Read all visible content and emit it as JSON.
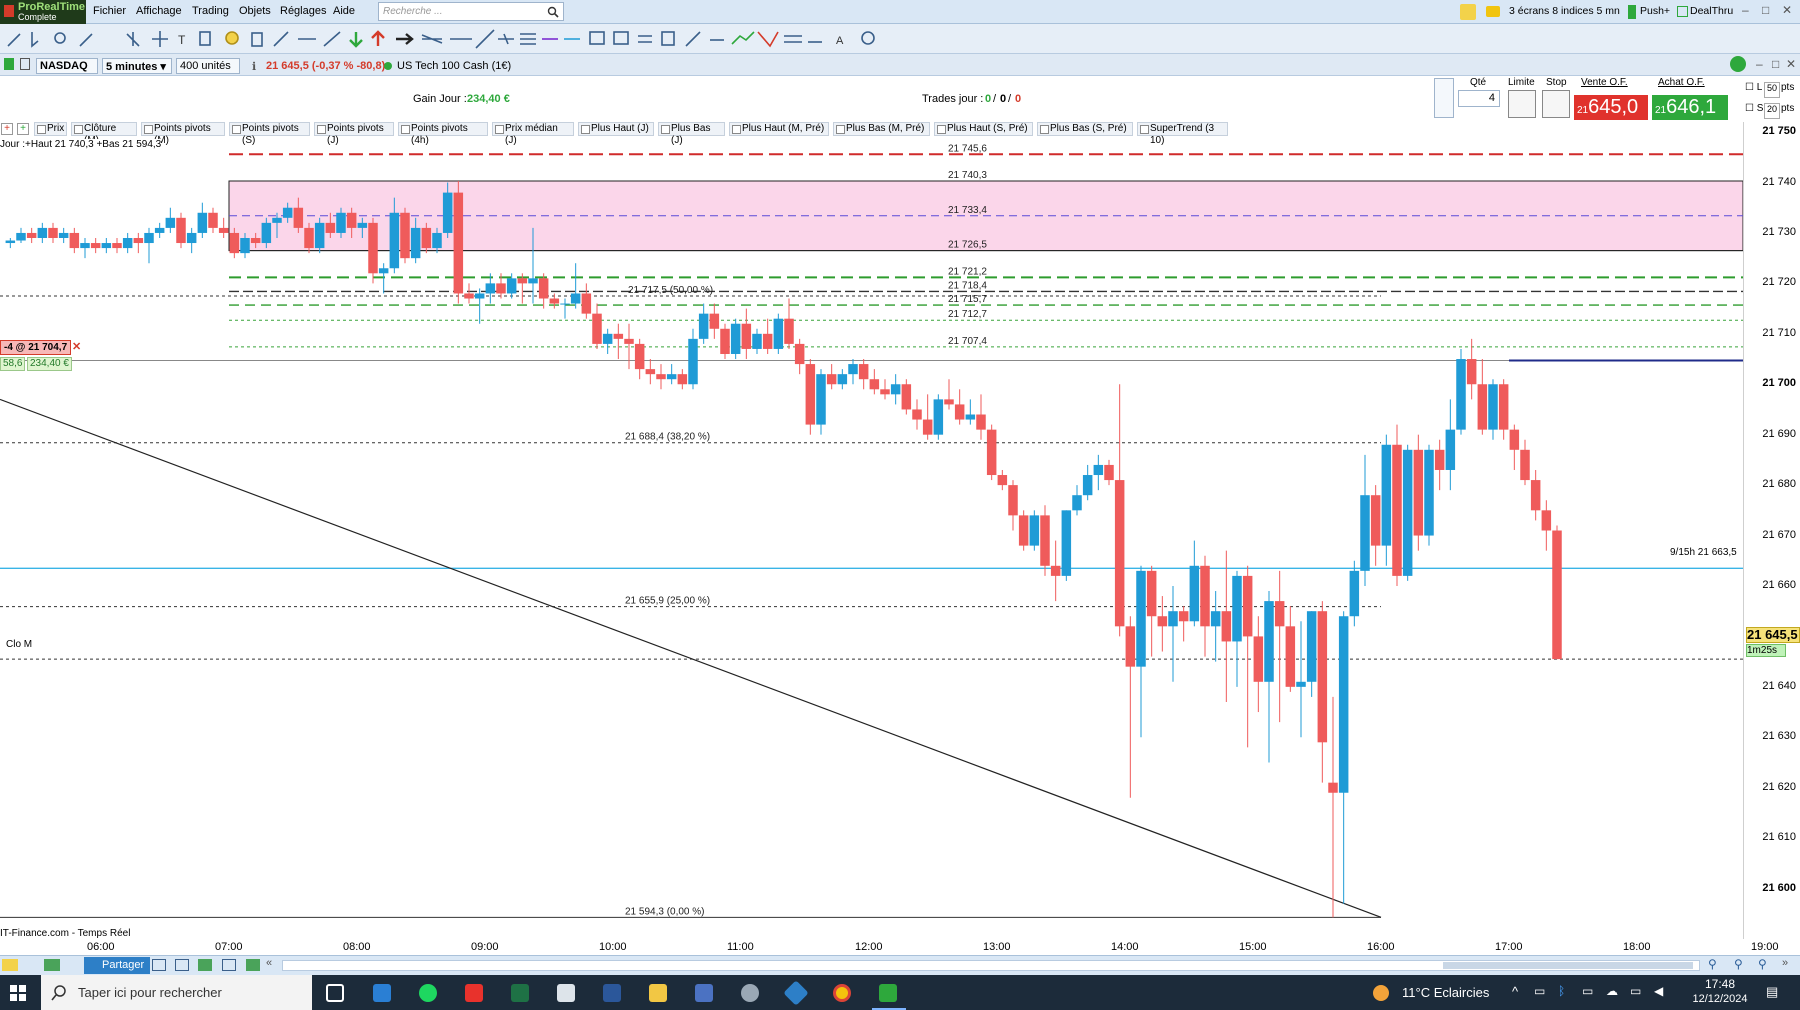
{
  "menubar": {
    "logo_top": "ProRealTime",
    "logo_bottom": "Complete",
    "items": [
      "Fichier",
      "Affichage",
      "Trading",
      "Objets",
      "Réglages",
      "Aide"
    ],
    "search_placeholder": "Recherche ...",
    "layout_label": "3 écrans 8 indices 5 mn",
    "push_label": "Push+",
    "dealthru_label": "DealThru"
  },
  "instrument": {
    "market": "NASDAQ",
    "timeframe": "5 minutes",
    "units": "400 unités",
    "quote": "21 645,5 (-0,37 % -80,8)",
    "name": "US Tech 100 Cash (1€)"
  },
  "order_panel": {
    "gain_label": "Gain Jour :",
    "gain_value": "234,40 €",
    "trades_label": "Trades jour :",
    "trades_value": "0",
    "trades_sep1": "/",
    "trades_value2": "0",
    "trades_sep2": "/",
    "trades_value3": "0",
    "qty_label": "Qté",
    "qty_value": "4",
    "limit_label": "Limite",
    "stop_label": "Stop",
    "sell_label": "Vente O.F.",
    "buy_label": "Achat O.F.",
    "sell_prefix": "21",
    "sell_price": "645,0",
    "buy_prefix": "21",
    "buy_price": "646,1",
    "l_label": "L",
    "s_label": "S",
    "l_pts": "50",
    "s_pts": "20",
    "pts": "pts",
    "colors": {
      "sell": "#e0322c",
      "buy": "#2ea83c"
    }
  },
  "indicators": [
    "Prix",
    "Clôture (M)",
    "Points pivots (M)",
    "Points pivots (S)",
    "Points pivots (J)",
    "Points pivots (4h)",
    "Prix médian (J)",
    "Plus Haut (J)",
    "Plus Bas (J)",
    "Plus Haut (M, Pré)",
    "Plus Bas (M, Pré)",
    "Plus Haut (S, Pré)",
    "Plus Bas (S, Pré)",
    "SuperTrend (3 10)"
  ],
  "chart_overlay": {
    "day_info": "Jour :+Haut 21 740,3 +Bas 21 594,3",
    "position_label": "-4 @ 21 704,7",
    "position_pnl_left": "58,6",
    "position_pnl_right": "234,40 €",
    "clo_m": "Clo M",
    "alert_label": "9/15h 21 663,5",
    "source": "IT-Finance.com - Temps Réel",
    "current_price": "21 645,5",
    "countdown": "1m25s"
  },
  "chart_data": {
    "type": "candlestick",
    "x_start": "05:15",
    "interval_minutes": 5,
    "candles": [
      [
        21728,
        21729,
        21727,
        21728.5
      ],
      [
        21728.5,
        21731,
        21728,
        21730
      ],
      [
        21730,
        21731,
        21728,
        21729
      ],
      [
        21729,
        21732,
        21728,
        21731
      ],
      [
        21731,
        21732,
        21728,
        21729
      ],
      [
        21729,
        21731,
        21728,
        21730
      ],
      [
        21730,
        21731,
        21726,
        21727
      ],
      [
        21727,
        21729,
        21725,
        21728
      ],
      [
        21728,
        21729,
        21726,
        21727
      ],
      [
        21727,
        21729,
        21726,
        21728
      ],
      [
        21728,
        21729,
        21726,
        21727
      ],
      [
        21727,
        21730,
        21726,
        21729
      ],
      [
        21729,
        21730,
        21726,
        21728
      ],
      [
        21728,
        21731,
        21724,
        21730
      ],
      [
        21730,
        21732,
        21729,
        21731
      ],
      [
        21731,
        21735,
        21730,
        21733
      ],
      [
        21733,
        21734,
        21727,
        21728
      ],
      [
        21728,
        21731,
        21726,
        21730
      ],
      [
        21730,
        21736,
        21729,
        21734
      ],
      [
        21734,
        21735,
        21730,
        21731
      ],
      [
        21731,
        21733,
        21729,
        21730
      ],
      [
        21730,
        21731,
        21725,
        21726
      ],
      [
        21726,
        21730,
        21725,
        21729
      ],
      [
        21729,
        21730,
        21727,
        21728
      ],
      [
        21728,
        21733,
        21727,
        21732
      ],
      [
        21732,
        21734,
        21729,
        21733
      ],
      [
        21733,
        21736,
        21732,
        21735
      ],
      [
        21735,
        21737,
        21730,
        21731
      ],
      [
        21731,
        21732,
        21726,
        21727
      ],
      [
        21727,
        21733,
        21726,
        21732
      ],
      [
        21732,
        21734,
        21729,
        21730
      ],
      [
        21730,
        21735,
        21729,
        21734
      ],
      [
        21734,
        21735,
        21729,
        21731
      ],
      [
        21731,
        21733,
        21729,
        21732
      ],
      [
        21732,
        21733,
        21720,
        21722
      ],
      [
        21722,
        21724,
        21718,
        21723
      ],
      [
        21723,
        21737,
        21722,
        21734
      ],
      [
        21734,
        21735,
        21724,
        21725
      ],
      [
        21725,
        21733,
        21724,
        21731
      ],
      [
        21731,
        21732,
        21726,
        21727
      ],
      [
        21727,
        21731,
        21726,
        21730
      ],
      [
        21730,
        21740,
        21729,
        21738
      ],
      [
        21738,
        21740.3,
        21716,
        21718
      ],
      [
        21718,
        21720,
        21716,
        21717
      ],
      [
        21717,
        21719,
        21712,
        21718
      ],
      [
        21718,
        21722,
        21716,
        21720
      ],
      [
        21720,
        21722,
        21717,
        21718
      ],
      [
        21718,
        21722,
        21717,
        21721
      ],
      [
        21721,
        21722,
        21716,
        21720
      ],
      [
        21720,
        21731,
        21716,
        21721
      ],
      [
        21721,
        21722,
        21715,
        21717
      ],
      [
        21717,
        21718,
        21715,
        21716
      ],
      [
        21716,
        21717,
        21713,
        21716
      ],
      [
        21716,
        21724,
        21715,
        21718
      ],
      [
        21718,
        21720,
        21713,
        21714
      ],
      [
        21714,
        21716,
        21707,
        21708
      ],
      [
        21708,
        21711,
        21706,
        21710
      ],
      [
        21710,
        21712,
        21705,
        21709
      ],
      [
        21709,
        21712,
        21703,
        21708
      ],
      [
        21708,
        21709,
        21701,
        21703
      ],
      [
        21703,
        21705,
        21700,
        21702
      ],
      [
        21702,
        21704,
        21699,
        21701
      ],
      [
        21701,
        21704,
        21700,
        21702
      ],
      [
        21702,
        21703,
        21699,
        21700
      ],
      [
        21700,
        21711,
        21699,
        21709
      ],
      [
        21709,
        21716,
        21708,
        21714
      ],
      [
        21714,
        21716,
        21709,
        21711
      ],
      [
        21711,
        21712,
        21705,
        21706
      ],
      [
        21706,
        21713,
        21705,
        21712
      ],
      [
        21712,
        21715,
        21705,
        21707
      ],
      [
        21707,
        21711,
        21706,
        21710
      ],
      [
        21710,
        21713,
        21706,
        21707
      ],
      [
        21707,
        21714,
        21706,
        21713
      ],
      [
        21713,
        21717,
        21707,
        21708
      ],
      [
        21708,
        21709,
        21702,
        21704
      ],
      [
        21704,
        21705,
        21690,
        21692
      ],
      [
        21692,
        21703,
        21690,
        21702
      ],
      [
        21702,
        21704,
        21699,
        21700
      ],
      [
        21700,
        21703,
        21699,
        21702
      ],
      [
        21702,
        21705,
        21700,
        21704
      ],
      [
        21704,
        21705,
        21699,
        21701
      ],
      [
        21701,
        21703,
        21698,
        21699
      ],
      [
        21699,
        21701,
        21697,
        21698
      ],
      [
        21698,
        21702,
        21696,
        21700
      ],
      [
        21700,
        21701,
        21694,
        21695
      ],
      [
        21695,
        21697,
        21691,
        21693
      ],
      [
        21693,
        21698,
        21689,
        21690
      ],
      [
        21690,
        21698,
        21689,
        21697
      ],
      [
        21697,
        21701,
        21695,
        21696
      ],
      [
        21696,
        21699,
        21692,
        21693
      ],
      [
        21693,
        21697,
        21692,
        21694
      ],
      [
        21694,
        21698,
        21689,
        21691
      ],
      [
        21691,
        21692,
        21681,
        21682
      ],
      [
        21682,
        21683,
        21679,
        21680
      ],
      [
        21680,
        21681,
        21671,
        21674
      ],
      [
        21674,
        21675,
        21667,
        21668
      ],
      [
        21668,
        21675,
        21667,
        21674
      ],
      [
        21674,
        21676,
        21662,
        21664
      ],
      [
        21664,
        21669,
        21657,
        21662
      ],
      [
        21662,
        21675,
        21661,
        21675
      ],
      [
        21675,
        21680,
        21674,
        21678
      ],
      [
        21678,
        21684,
        21677,
        21682
      ],
      [
        21682,
        21686,
        21679,
        21684
      ],
      [
        21684,
        21685,
        21680,
        21681
      ],
      [
        21681,
        21700,
        21650,
        21652
      ],
      [
        21652,
        21654,
        21618,
        21644
      ],
      [
        21644,
        21664,
        21630,
        21663
      ],
      [
        21663,
        21664,
        21646,
        21654
      ],
      [
        21654,
        21658,
        21647,
        21652
      ],
      [
        21652,
        21660,
        21641,
        21655
      ],
      [
        21655,
        21656,
        21649,
        21653
      ],
      [
        21653,
        21669,
        21652,
        21664
      ],
      [
        21664,
        21666,
        21646,
        21652
      ],
      [
        21652,
        21659,
        21645,
        21655
      ],
      [
        21655,
        21667,
        21637,
        21649
      ],
      [
        21649,
        21663,
        21640,
        21662
      ],
      [
        21662,
        21664,
        21628,
        21650
      ],
      [
        21650,
        21654,
        21635,
        21641
      ],
      [
        21641,
        21659,
        21625,
        21657
      ],
      [
        21657,
        21663,
        21633,
        21652
      ],
      [
        21652,
        21656,
        21639,
        21640
      ],
      [
        21640,
        21653,
        21630,
        21641
      ],
      [
        21641,
        21655,
        21638,
        21655
      ],
      [
        21655,
        21657,
        21621,
        21629
      ],
      [
        21621,
        21638,
        21594.3,
        21619
      ],
      [
        21619,
        21655,
        21597,
        21654
      ],
      [
        21654,
        21665,
        21652,
        21663
      ],
      [
        21663,
        21686,
        21660,
        21678
      ],
      [
        21678,
        21680,
        21664,
        21668
      ],
      [
        21668,
        21690,
        21664,
        21688
      ],
      [
        21688,
        21692,
        21660,
        21662
      ],
      [
        21662,
        21688,
        21661,
        21687
      ],
      [
        21687,
        21690,
        21667,
        21670
      ],
      [
        21670,
        21688,
        21668,
        21687
      ],
      [
        21687,
        21689,
        21679,
        21683
      ],
      [
        21683,
        21697,
        21679,
        21691
      ],
      [
        21691,
        21707,
        21690,
        21705
      ],
      [
        21705,
        21709,
        21697,
        21700
      ],
      [
        21700,
        21705,
        21690,
        21691
      ],
      [
        21691,
        21701,
        21689,
        21700
      ],
      [
        21700,
        21701,
        21689,
        21691
      ],
      [
        21691,
        21692,
        21683,
        21687
      ],
      [
        21687,
        21689,
        21680,
        21681
      ],
      [
        21681,
        21683,
        21673,
        21675
      ],
      [
        21675,
        21677,
        21667,
        21671
      ],
      [
        21671,
        21672,
        21645.5,
        21645.5
      ]
    ],
    "levels": [
      {
        "label": "21 745,6",
        "value": 21745.6
      },
      {
        "label": "21 740,3",
        "value": 21740.3
      },
      {
        "label": "21 733,4",
        "value": 21733.4
      },
      {
        "label": "21 726,5",
        "value": 21726.5
      },
      {
        "label": "21 721,2",
        "value": 21721.2
      },
      {
        "label": "21 718,4",
        "value": 21718.4
      },
      {
        "label": "21 715,7",
        "value": 21715.7
      },
      {
        "label": "21 712,7",
        "value": 21712.7
      },
      {
        "label": "21 707,4",
        "value": 21707.4
      }
    ],
    "fib": [
      {
        "label": "21 717,5 (50,00 %)",
        "value": 21717.5
      },
      {
        "label": "21 688,4 (38,20 %)",
        "value": 21688.4
      },
      {
        "label": "21 655,9 (25,00 %)",
        "value": 21655.9
      },
      {
        "label": "21 594,3 (0,00 %)",
        "value": 21594.3
      }
    ],
    "position_value": 21704.7,
    "alert_value": 21663.5,
    "clo_value": 21645.5,
    "trendline": [
      [
        "05:15",
        21697
      ],
      [
        "16:00",
        21594.3
      ]
    ],
    "ylim": [
      21590,
      21752
    ],
    "y_ticks": [
      "21 750",
      "21 740",
      "21 730",
      "21 720",
      "21 710",
      "21 700",
      "21 690",
      "21 680",
      "21 670",
      "21 660",
      "21 650",
      "21 640",
      "21 630",
      "21 620",
      "21 610",
      "21 600"
    ],
    "y_tick_values": [
      21750,
      21740,
      21730,
      21720,
      21710,
      21700,
      21690,
      21680,
      21670,
      21660,
      21650,
      21640,
      21630,
      21620,
      21610,
      21600
    ],
    "x_ticks": [
      "06:00",
      "07:00",
      "08:00",
      "09:00",
      "10:00",
      "11:00",
      "12:00",
      "13:00",
      "14:00",
      "15:00",
      "16:00",
      "17:00",
      "18:00",
      "19:00"
    ],
    "colors": {
      "up": "#1f9bd6",
      "down": "#ef5b5b",
      "zone": "#fbd6ea",
      "alert": "#39b4e6",
      "position": "#1f2b8a"
    }
  },
  "taskbar": {
    "search_placeholder": "Taper ici pour rechercher",
    "weather": "11°C  Eclaircies",
    "time": "17:48",
    "date": "12/12/2024"
  },
  "navbar": {
    "share_label": "Partager"
  }
}
